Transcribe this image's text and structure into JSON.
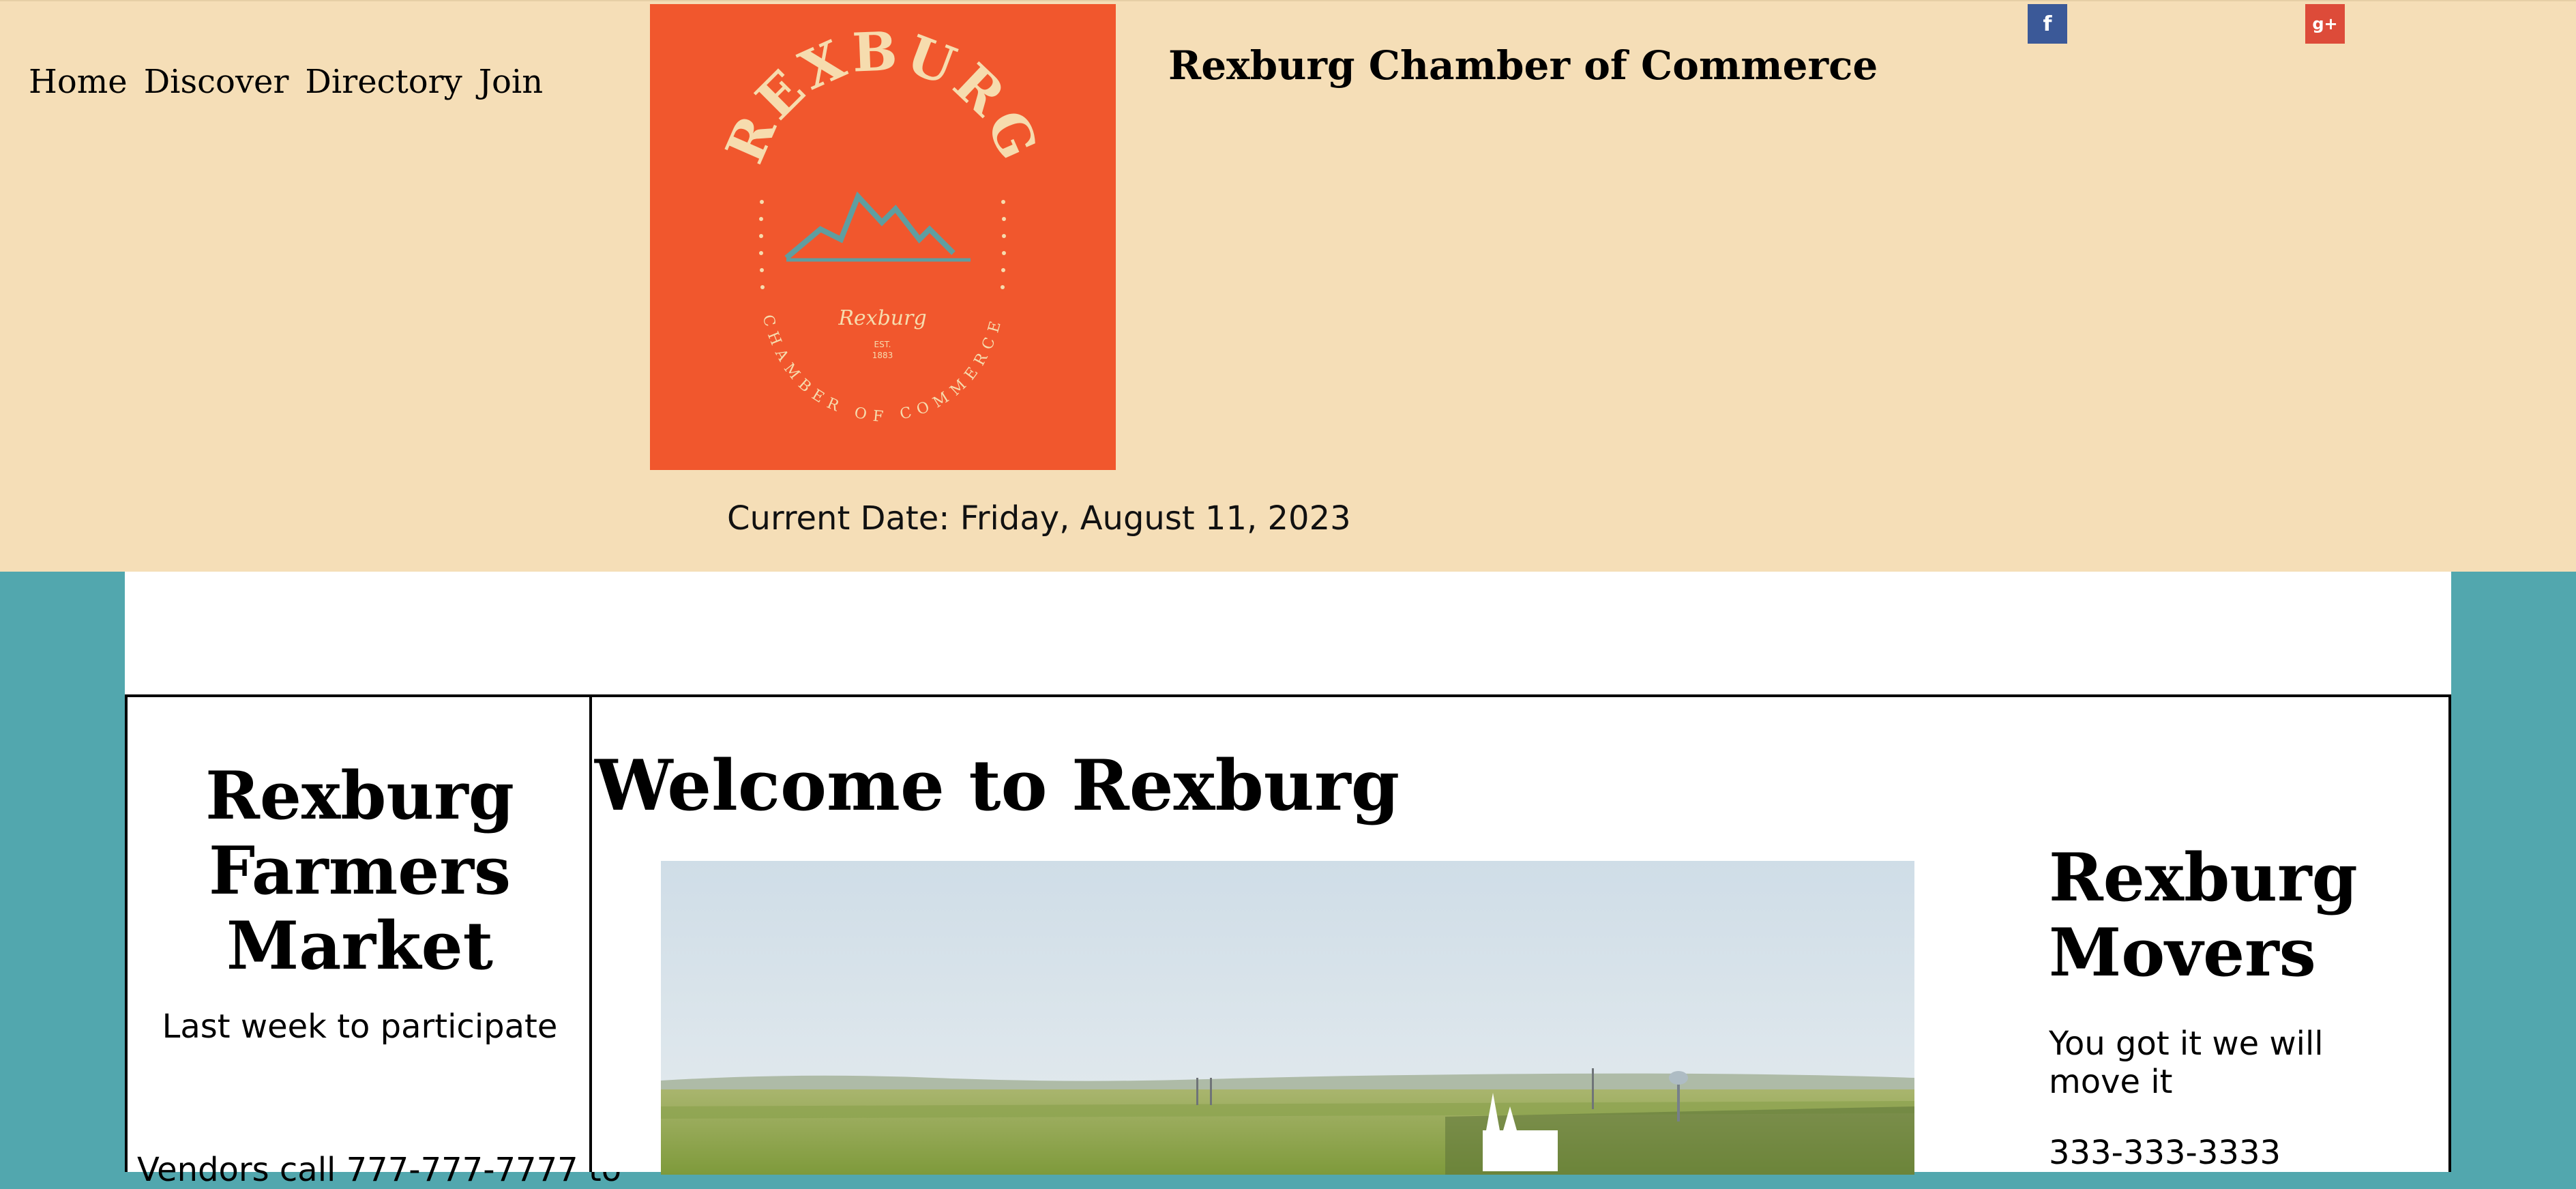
{
  "nav": {
    "items": [
      "Home",
      "Discover",
      "Directory",
      "Join"
    ]
  },
  "logo": {
    "arc_text": "REXBURG",
    "script_text": "Rexburg",
    "est": "EST.",
    "year": "1883",
    "bottom_text": "CHAMBER OF COMMERCE",
    "colors": {
      "background": "#f1572d",
      "text": "#f6dcae",
      "mountain": "#5f9ea0"
    }
  },
  "header": {
    "site_title": "Rexburg Chamber of Commerce"
  },
  "social": {
    "facebook_icon": "f",
    "googleplus_icon": "g+"
  },
  "date": {
    "text": "Current Date: Friday, August 11, 2023"
  },
  "left_panel": {
    "title": "Rexburg Farmers Market",
    "subtitle": "Last week to participate",
    "vendors": "Vendors call 777-777-7777 to"
  },
  "center_panel": {
    "heading": "Welcome to Rexburg"
  },
  "right_panel": {
    "title": "Rexburg Movers",
    "tagline": "You got it we will move it",
    "phone": "333-333-3333"
  },
  "colors": {
    "header_bg": "#f5deb7",
    "page_bg": "#52a7ae",
    "content_bg": "#ffffff"
  }
}
